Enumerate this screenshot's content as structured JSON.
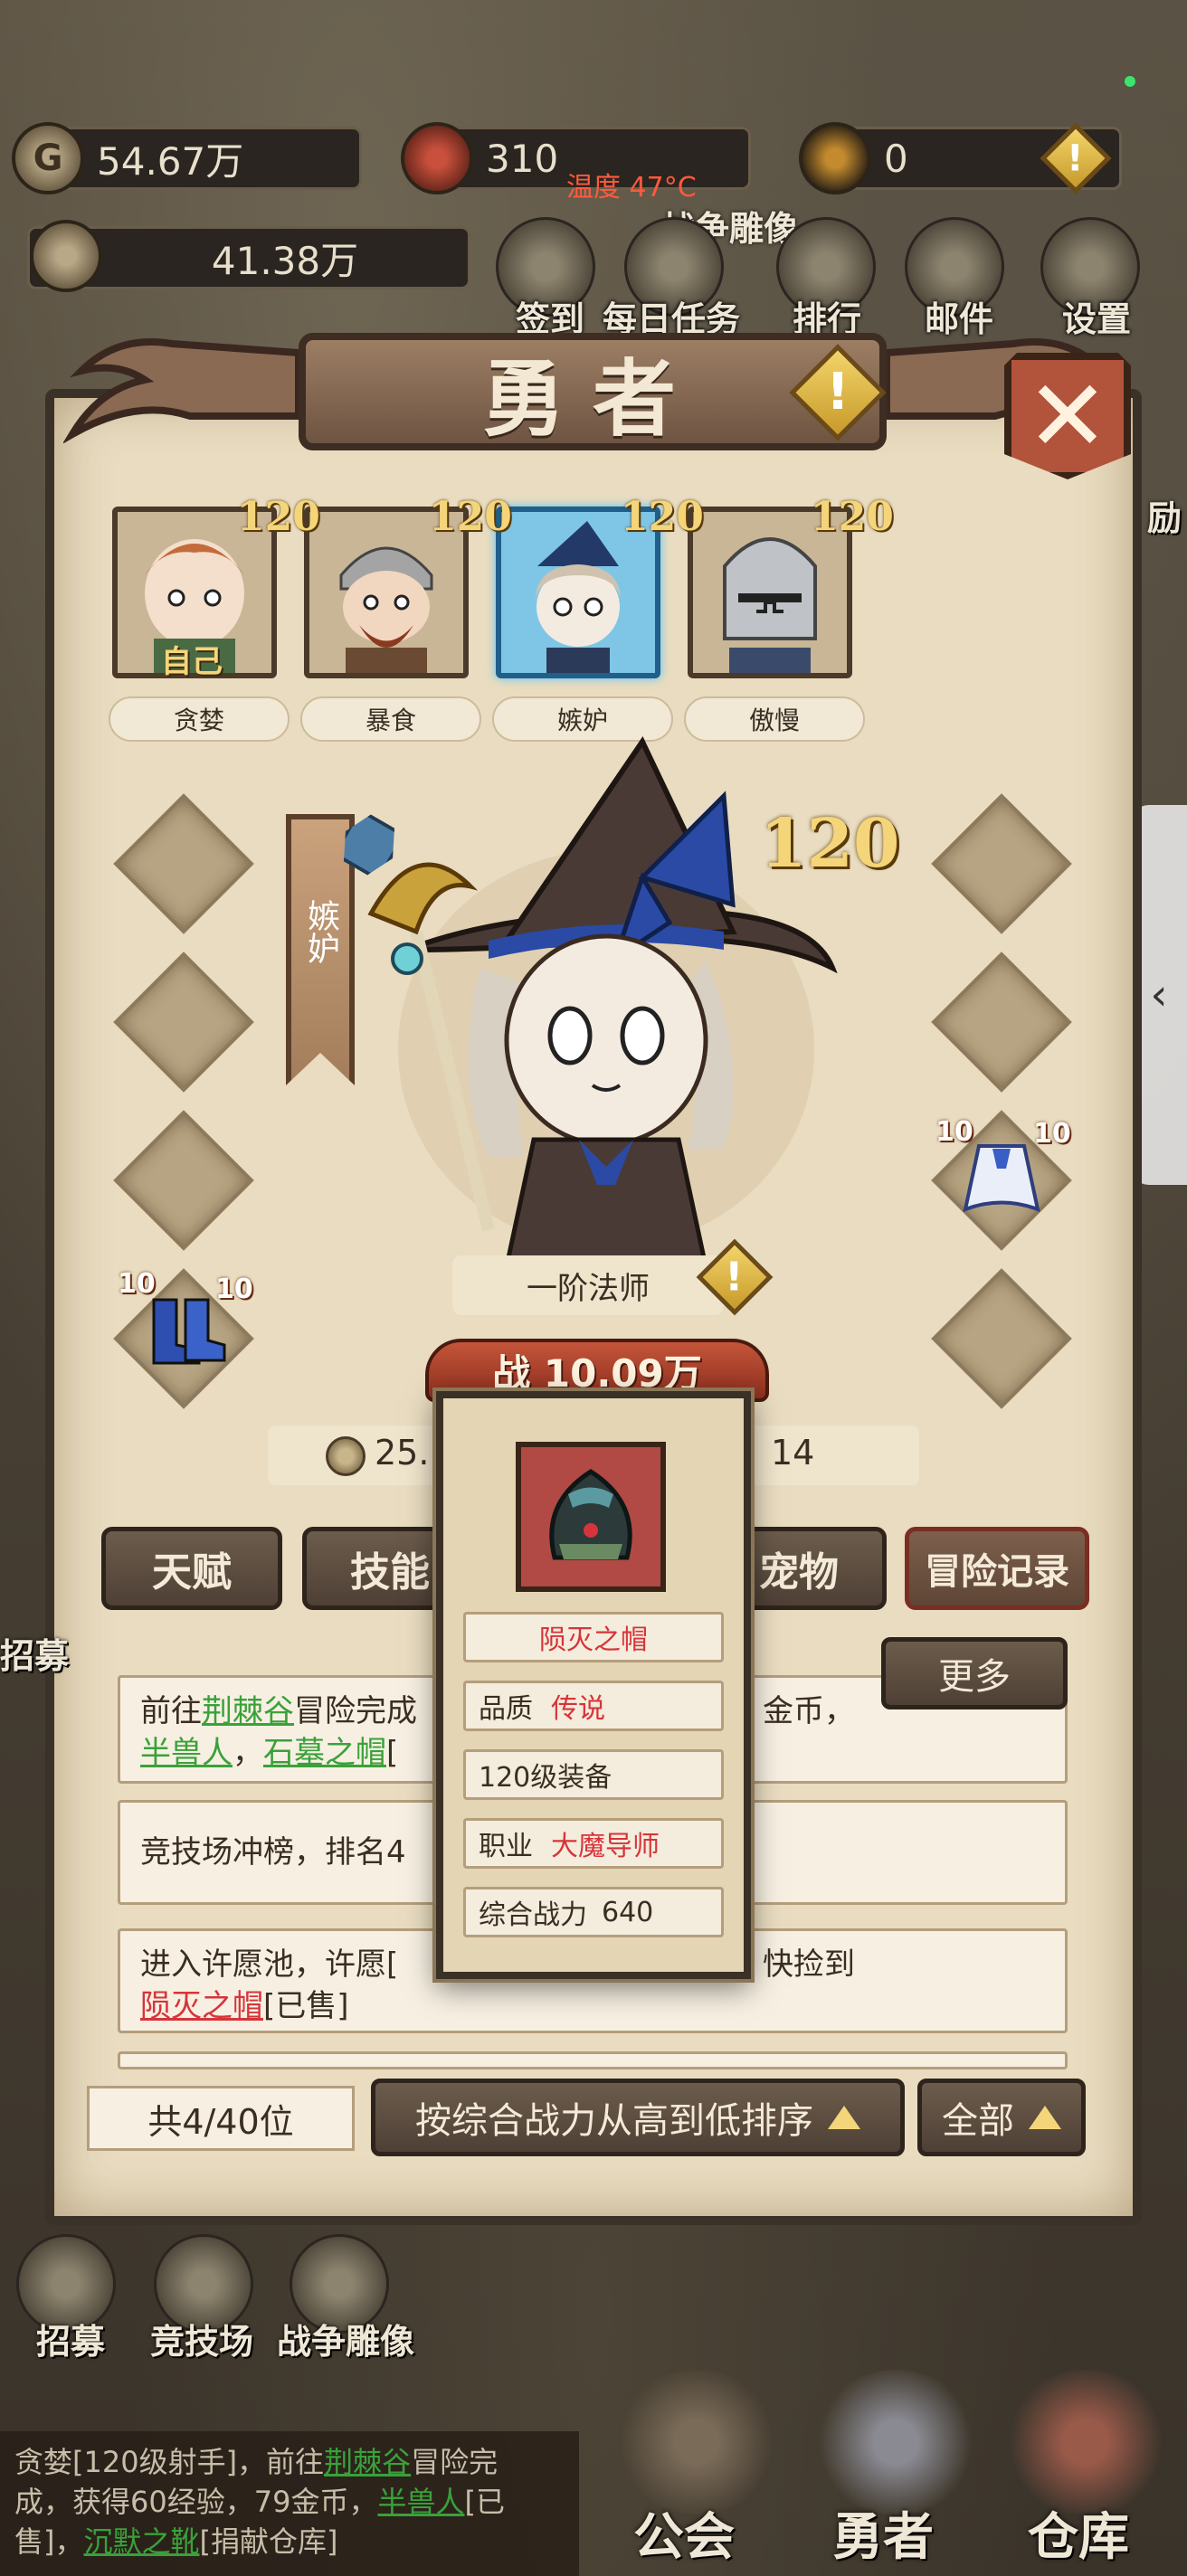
{
  "status_bar": {
    "temperature": "温度 47°C"
  },
  "resources": [
    {
      "icon": "coin-icon",
      "value": "54.67万"
    },
    {
      "icon": "crest-icon",
      "value": "310"
    },
    {
      "icon": "gem-icon",
      "value": "0"
    },
    {
      "icon": "power-icon",
      "value": "41.38万"
    }
  ],
  "top_menu": {
    "war_statue_label": "战争雕像",
    "items": [
      "签到",
      "每日任务",
      "排行",
      "邮件",
      "设置"
    ]
  },
  "panel": {
    "title": "勇者",
    "warning_glyph": "!",
    "close_glyph": "✕"
  },
  "heroes": [
    {
      "name": "贪婪",
      "level": "120",
      "self_tag": "自己",
      "selected": false
    },
    {
      "name": "暴食",
      "level": "120",
      "selected": false
    },
    {
      "name": "嫉妒",
      "level": "120",
      "selected": true
    },
    {
      "name": "傲慢",
      "level": "120",
      "selected": false
    }
  ],
  "selected_hero": {
    "banner_name": "嫉妒",
    "level": "120",
    "class_rank": "一阶法师",
    "power_label": "战 10.09万",
    "gold_partial": "25.",
    "stat_right": "14"
  },
  "equipment": {
    "left_boots_levels": [
      "10",
      "10"
    ],
    "right_cape_levels": [
      "10",
      "10"
    ]
  },
  "tabs": [
    "天赋",
    "技能",
    "宠物",
    "冒险记录"
  ],
  "more_button": "更多",
  "log": {
    "entry1_prefix": "前往",
    "entry1_place": "荆棘谷",
    "entry1_mid": "冒险完成",
    "entry1_end": "金币，",
    "entry1_l2_a": "半兽人",
    "entry1_l2_sep": "，",
    "entry1_l2_b": "石墓之帽",
    "entry1_l2_c": "[",
    "entry2": "竞技场冲榜，排名4",
    "entry3_l1a": "进入许愿池，许愿[",
    "entry3_l1b": "快捡到",
    "entry3_item": "陨灭之帽",
    "entry3_tail": "[已售]"
  },
  "popup": {
    "item_name": "陨灭之帽",
    "quality_label": "品质",
    "quality_value": "传说",
    "level_req": "120级装备",
    "class_label": "职业",
    "class_value": "大魔导师",
    "power_label": "综合战力",
    "power_value": "640"
  },
  "footer": {
    "count": "共4/40位",
    "sort_label": "按综合战力从高到低排序",
    "filter_label": "全部"
  },
  "left_menu": [
    "招募",
    "竞技场",
    "战争雕像"
  ],
  "left_edge_label": "招募",
  "right_edge_label": "励",
  "bottom_nav": [
    "公会",
    "勇者",
    "仓库"
  ],
  "chat_ticker": {
    "line1a": "贪婪[120级射手]，前往",
    "line1b": "荆棘谷",
    "line1c": "冒险完",
    "line2a": "成，获得60经验，79金币，",
    "line2b": "半兽人",
    "line2c": "[已",
    "line3a": "售]，",
    "line3b": "沉默之靴",
    "line3c": "[捐献仓库]"
  },
  "side_handle_glyph": "‹",
  "colors": {
    "panel_bg": "#e9dcc0",
    "accent_red": "#d6343a",
    "accent_green": "#3aa13a",
    "level_gold": "#f5d57a",
    "selected_blue": "#7fc6e6"
  }
}
